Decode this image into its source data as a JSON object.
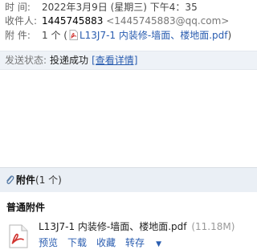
{
  "header": {
    "time_label": "时 间:",
    "time_value": "2022年3月9日 (星期三) 下午4：35",
    "from_label": "收件人:",
    "from_name": "1445745883",
    "from_address": "<1445745883@qq.com>",
    "attach_label": "附 件:",
    "attach_count": "1 个 (",
    "attach_name": "L13J7-1 内装修-墙面、楼地面.pdf",
    "attach_close": ")",
    "pdf_icon": "pdf-icon"
  },
  "status": {
    "label": "发送状态:",
    "value": "投递成功",
    "link": "[查看详情]"
  },
  "attachments": {
    "title": "附件",
    "count": "(1 个)",
    "group_title": "普通附件",
    "clip_icon": "paperclip-icon",
    "file": {
      "name": "L13J7-1 内装修-墙面、楼地面.pdf",
      "size": "(11.18M)",
      "icon": "pdf-icon",
      "actions": {
        "preview": "预览",
        "download": "下载",
        "collect": "收藏",
        "forward": "转存"
      }
    }
  },
  "colors": {
    "link": "#2a5db0",
    "status_bg": "#eef2f7",
    "pdf_red": "#d0312d"
  }
}
